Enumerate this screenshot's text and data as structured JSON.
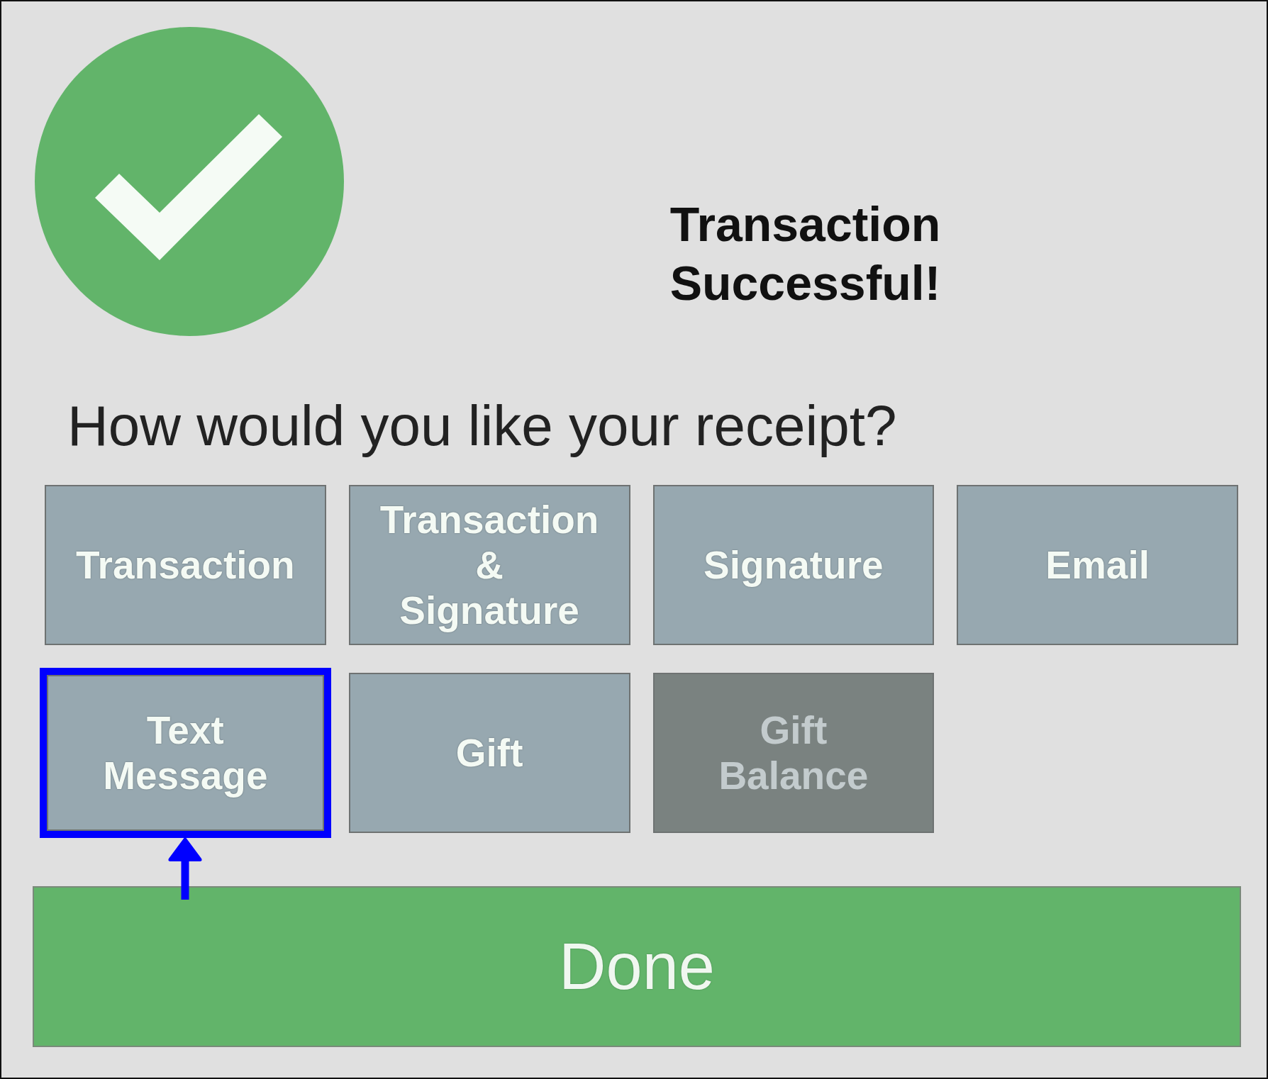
{
  "status": {
    "title": "Transaction\nSuccessful!"
  },
  "prompt": "How would you like your receipt?",
  "options": [
    {
      "label": "Transaction",
      "disabled": false,
      "highlighted": false
    },
    {
      "label": "Transaction\n&\nSignature",
      "disabled": false,
      "highlighted": false
    },
    {
      "label": "Signature",
      "disabled": false,
      "highlighted": false
    },
    {
      "label": "Email",
      "disabled": false,
      "highlighted": false
    },
    {
      "label": "Text\nMessage",
      "disabled": false,
      "highlighted": true
    },
    {
      "label": "Gift",
      "disabled": false,
      "highlighted": false
    },
    {
      "label": "Gift\nBalance",
      "disabled": true,
      "highlighted": false
    }
  ],
  "done_button": {
    "label": "Done"
  }
}
